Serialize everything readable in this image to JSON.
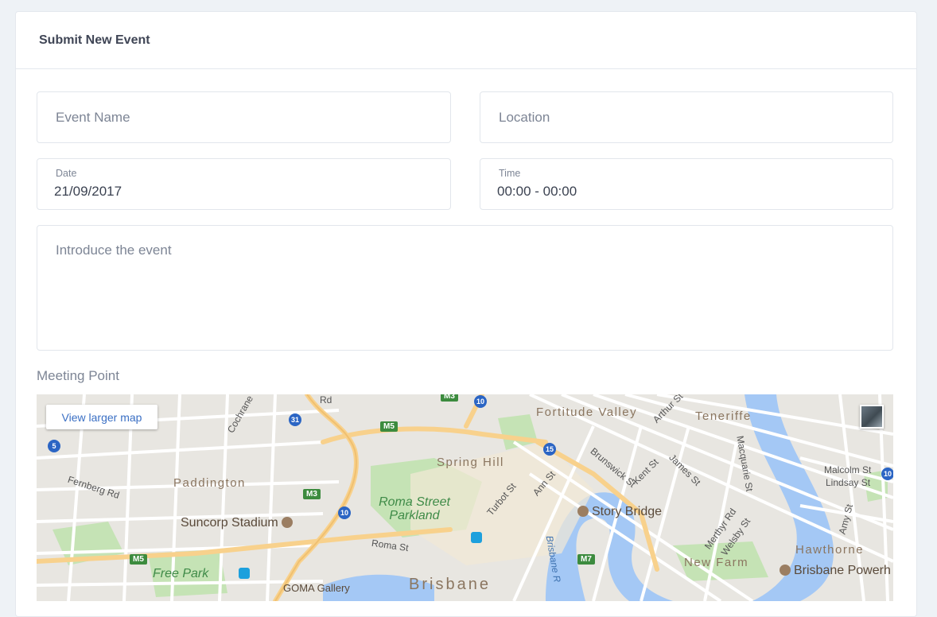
{
  "card": {
    "title": "Submit New Event"
  },
  "form": {
    "event_name_placeholder": "Event Name",
    "location_placeholder": "Location",
    "date_label": "Date",
    "date_value": "21/09/2017",
    "time_label": "Time",
    "time_value": "00:00 - 00:00",
    "intro_placeholder": "Introduce the event",
    "meeting_point_label": "Meeting Point"
  },
  "map": {
    "view_larger_label": "View larger map",
    "suburbs": [
      "Fortitude Valley",
      "Teneriffe",
      "Spring Hill",
      "Paddington",
      "Hawthorne",
      "New Farm",
      "Brisbane"
    ],
    "streets": [
      "Cochrane",
      "Fernberg Rd",
      "Roma St",
      "Turbot St",
      "Ann St",
      "Brunswick St",
      "Kent St",
      "James St",
      "Arthur St",
      "Macquarie St",
      "Malcolm St",
      "Lindsay St",
      "Amy St",
      "Merthyr Rd",
      "Welsby St",
      "Rd"
    ],
    "pois": [
      "Story Bridge",
      "Suncorp Stadium",
      "Brisbane Powerh",
      "GOMA Gallery"
    ],
    "parks": [
      "Roma Street Parkland",
      "Free Park"
    ],
    "water": [
      "Brisbane R"
    ],
    "route_shields": [
      "M3",
      "M5",
      "M5",
      "M3",
      "M5",
      "M7"
    ],
    "route_badges": [
      "31",
      "10",
      "10",
      "15",
      "5",
      "10"
    ],
    "colors": {
      "water": "#a4c8f5",
      "park": "#c5e3b5",
      "road_major": "#f8d18c",
      "land": "#e8e6e1"
    }
  }
}
